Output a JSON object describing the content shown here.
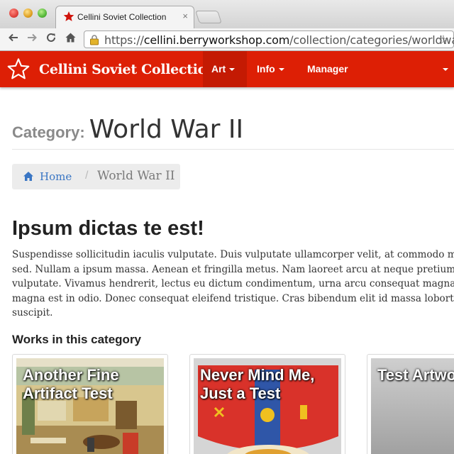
{
  "browser": {
    "tab_title": "Cellini Soviet Collection",
    "tab_close": "×",
    "url_scheme": "https://",
    "url_host": "cellini.berryworkshop.com",
    "url_path": "/collection/categories/worldwa...",
    "icons": [
      "red-star-favicon",
      "back-icon",
      "forward-icon",
      "reload-icon",
      "home-icon",
      "lock-icon",
      "bookmark-star-icon"
    ]
  },
  "navbar": {
    "brand": "Cellini Soviet Collection",
    "items": [
      {
        "label": "Art",
        "has_caret": true,
        "active": true
      },
      {
        "label": "Info",
        "has_caret": true,
        "active": false
      },
      {
        "label": "Manager",
        "has_caret": false,
        "active": false
      }
    ],
    "background_color": "#dd1f05"
  },
  "page": {
    "category_label": "Category:",
    "category_title": "World War II",
    "breadcrumb": {
      "home": "Home",
      "separator": "/",
      "current": "World War II"
    },
    "article_heading": "Ipsum dictas te est!",
    "body_lines": [
      "Suspendisse sollicitudin iaculis vulputate. Duis vulputate ullamcorper velit, at commodo mag",
      "sed. Nullam a ipsum massa. Aenean et fringilla metus. Nam laoreet arcu at neque pretium id s",
      "vulputate. Vivamus hendrerit, lectus eu dictum condimentum, urna arcu consequat magna, n",
      "magna est in odio. Donec consequat eleifend tristique. Cras bibendum elit id massa lobortis ve",
      "suscipit."
    ],
    "works_heading": "Works in this category",
    "works": [
      {
        "title": "Another Fine Artifact Test"
      },
      {
        "title": "Never Mind Me, Just a Test"
      },
      {
        "title": "Test Artwo"
      }
    ]
  }
}
